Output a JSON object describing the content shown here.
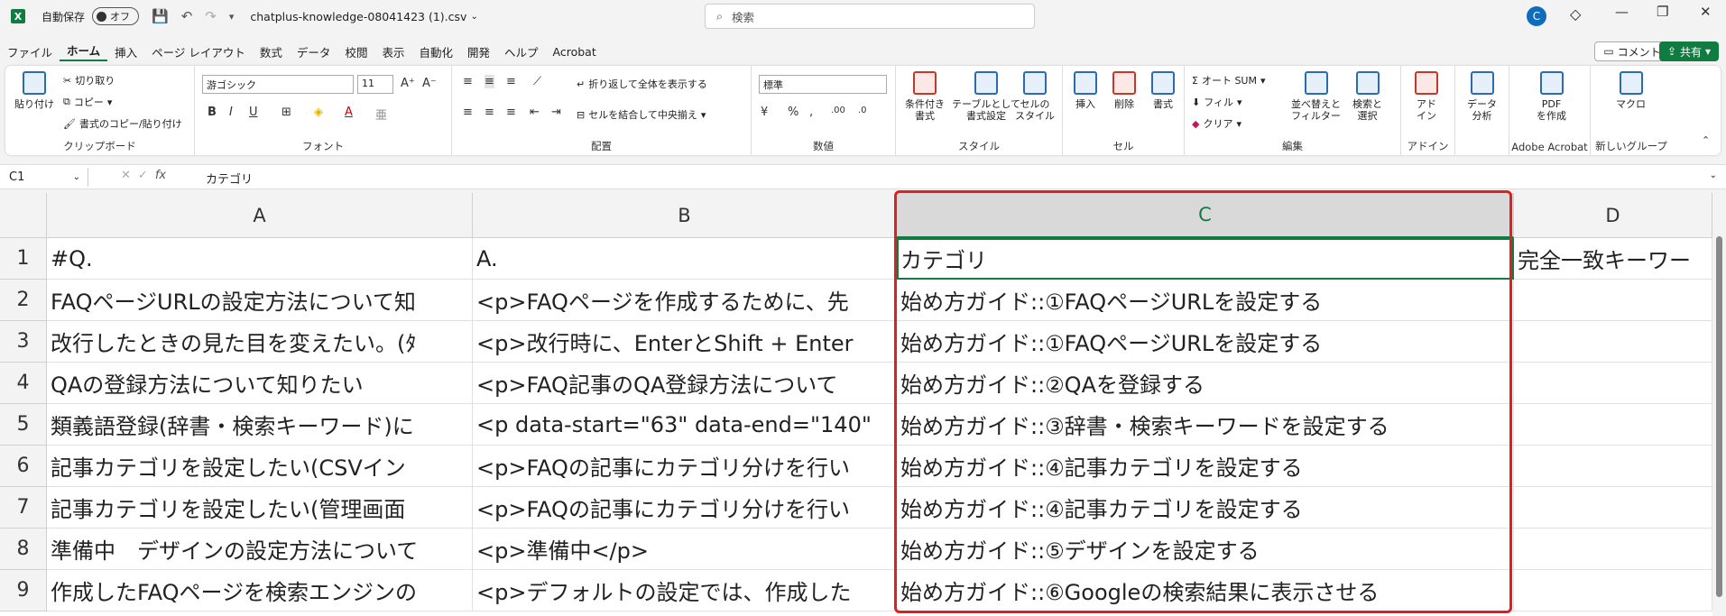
{
  "titlebar": {
    "autosave_label": "自動保存",
    "toggle_state": "オフ",
    "filename": "chatplus-knowledge-08041423 (1).csv",
    "search_placeholder": "検索",
    "account_initial": "C"
  },
  "menu": [
    "ファイル",
    "ホーム",
    "挿入",
    "ページ レイアウト",
    "数式",
    "データ",
    "校閲",
    "表示",
    "自動化",
    "開発",
    "ヘルプ",
    "Acrobat"
  ],
  "menu_active": "ホーム",
  "comment_label": "コメント",
  "share_label": "共有",
  "ribbon": {
    "clipboard": {
      "label": "クリップボード",
      "paste": "貼り付け",
      "cut": "切り取り",
      "copy": "コピー",
      "format_painter": "書式のコピー/貼り付け"
    },
    "font": {
      "label": "フォント",
      "font_name": "游ゴシック",
      "font_size": "11"
    },
    "alignment": {
      "label": "配置",
      "wrap": "折り返して全体を表示する",
      "merge": "セルを結合して中央揃え"
    },
    "number": {
      "label": "数値",
      "format": "標準"
    },
    "styles": {
      "label": "スタイル",
      "cond": "条件付き\n書式",
      "table": "テーブルとして\n書式設定",
      "cell": "セルの\nスタイル"
    },
    "cells": {
      "label": "セル",
      "insert": "挿入",
      "delete": "削除",
      "format": "書式"
    },
    "editing": {
      "label": "編集",
      "autosum": "オート SUM",
      "fill": "フィル",
      "clear": "クリア",
      "sort": "並べ替えと\nフィルター",
      "find": "検索と\n選択"
    },
    "addins": {
      "label": "アドイン",
      "addin": "アド\nイン"
    },
    "analysis": {
      "analyze": "データ\n分析"
    },
    "acrobat": {
      "label": "Adobe Acrobat",
      "pdf": "PDF\nを作成"
    },
    "newgroup": {
      "label": "新しいグループ",
      "macro": "マクロ"
    }
  },
  "formula_bar": {
    "cell_ref": "C1",
    "value": "カテゴリ"
  },
  "columns": [
    "A",
    "B",
    "C",
    "D"
  ],
  "selected_column": "C",
  "rows": [
    {
      "n": "1",
      "a": "#Q.",
      "b": "A.",
      "c": "カテゴリ",
      "d": "完全一致キーワー"
    },
    {
      "n": "2",
      "a": "FAQページURLの設定方法について知",
      "b": "<p>FAQページを作成するために、先",
      "c": "始め方ガイド::①FAQページURLを設定する",
      "d": ""
    },
    {
      "n": "3",
      "a": "改行したときの見た目を変えたい。(ﾀ",
      "b": "<p>改行時に、EnterとShift + Enter",
      "c": "始め方ガイド::①FAQページURLを設定する",
      "d": ""
    },
    {
      "n": "4",
      "a": "QAの登録方法について知りたい",
      "b": "<p>FAQ記事のQA登録方法について",
      "c": "始め方ガイド::②QAを登録する",
      "d": ""
    },
    {
      "n": "5",
      "a": "類義語登録(辞書・検索キーワード)に",
      "b": "<p data-start=\"63\" data-end=\"140\"",
      "c": "始め方ガイド::③辞書・検索キーワードを設定する",
      "d": ""
    },
    {
      "n": "6",
      "a": "記事カテゴリを設定したい(CSVイン",
      "b": "<p>FAQの記事にカテゴリ分けを行い",
      "c": "始め方ガイド::④記事カテゴリを設定する",
      "d": ""
    },
    {
      "n": "7",
      "a": "記事カテゴリを設定したい(管理画面",
      "b": "<p>FAQの記事にカテゴリ分けを行い",
      "c": "始め方ガイド::④記事カテゴリを設定する",
      "d": ""
    },
    {
      "n": "8",
      "a": "準備中　デザインの設定方法について",
      "b": "<p>準備中</p>",
      "c": "始め方ガイド::⑤デザインを設定する",
      "d": ""
    },
    {
      "n": "9",
      "a": "作成したFAQページを検索エンジンの",
      "b": "<p>デフォルトの設定では、作成した",
      "c": "始め方ガイド::⑥Googleの検索結果に表示させる",
      "d": ""
    }
  ],
  "colors": {
    "excel_green": "#107c41",
    "highlight": "#e02020"
  }
}
